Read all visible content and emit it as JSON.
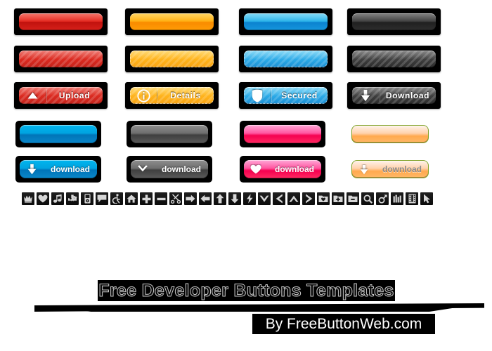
{
  "page": {
    "title": "Free Developer Buttons Templates",
    "credit": "By FreeButtonWeb.com",
    "background": "#ffffff"
  },
  "group1": {
    "plate_color": "#000000",
    "rows": [
      {
        "row_name": "plain",
        "buttons": [
          {
            "name": "red-plain-button",
            "label": "",
            "icon": "",
            "color": "#e32319",
            "striped": false
          },
          {
            "name": "orange-plain-button",
            "label": "",
            "icon": "",
            "color": "#ffad0a",
            "striped": false
          },
          {
            "name": "blue-plain-button",
            "label": "",
            "icon": "",
            "color": "#23b0e8",
            "striped": false
          },
          {
            "name": "dark-plain-button",
            "label": "",
            "icon": "",
            "color": "#3a3a3a",
            "striped": false
          }
        ]
      },
      {
        "row_name": "striped",
        "buttons": [
          {
            "name": "red-striped-button",
            "label": "",
            "icon": "",
            "color": "#dc2a20",
            "striped": true
          },
          {
            "name": "orange-striped-button",
            "label": "",
            "icon": "",
            "color": "#ffb41c",
            "striped": true
          },
          {
            "name": "blue-striped-button",
            "label": "",
            "icon": "",
            "color": "#2ba9e6",
            "striped": true
          },
          {
            "name": "dark-striped-button",
            "label": "",
            "icon": "",
            "color": "#404040",
            "striped": true
          }
        ]
      },
      {
        "row_name": "labeled",
        "buttons": [
          {
            "name": "upload-button",
            "label": "Upload",
            "icon": "triangle-up-icon",
            "color": "#dc2a20",
            "striped": true
          },
          {
            "name": "details-button",
            "label": "Details",
            "icon": "info-circle-icon",
            "color": "#ffb41c",
            "striped": true
          },
          {
            "name": "secured-button",
            "label": "Secured",
            "icon": "shield-icon",
            "color": "#2ba9e6",
            "striped": true
          },
          {
            "name": "download-button",
            "label": "Download",
            "icon": "arrow-down-icon",
            "color": "#404040",
            "striped": true
          }
        ]
      }
    ]
  },
  "group2": {
    "rows": [
      {
        "row_name": "plain",
        "buttons": [
          {
            "name": "blue-pill-plain",
            "label": "",
            "icon": "",
            "color": "#00a3e0",
            "plate": true
          },
          {
            "name": "gray-pill-plain",
            "label": "",
            "icon": "",
            "color": "#6e6e6e",
            "plate": true
          },
          {
            "name": "pink-pill-plain",
            "label": "",
            "icon": "",
            "color": "#ff56a0",
            "plate": true
          },
          {
            "name": "peach-pill-plain",
            "label": "",
            "icon": "",
            "color": "#ffb866",
            "plate": false
          }
        ]
      },
      {
        "row_name": "labeled",
        "buttons": [
          {
            "name": "blue-download-pill",
            "label": "download",
            "icon": "arrow-down-icon",
            "color": "#00a3e0",
            "plate": true,
            "label_dark": false
          },
          {
            "name": "gray-download-pill",
            "label": "download",
            "icon": "chevron-down-icon",
            "color": "#6e6e6e",
            "plate": true,
            "label_dark": false
          },
          {
            "name": "pink-download-pill",
            "label": "download",
            "icon": "heart-icon",
            "color": "#ff56a0",
            "plate": true,
            "label_dark": false
          },
          {
            "name": "peach-download-pill",
            "label": "download",
            "icon": "arrow-down-icon",
            "color": "#ffb866",
            "plate": false,
            "label_dark": true
          }
        ]
      }
    ]
  },
  "icon_strip": [
    "crown-icon",
    "heart-icon",
    "music-note-icon",
    "puzzle-piece-icon",
    "media-player-icon",
    "speech-bubble-icon",
    "wheelchair-icon",
    "home-icon",
    "plus-icon",
    "minus-icon",
    "scissors-icon",
    "arrow-right-icon",
    "arrow-left-icon",
    "arrow-up-icon",
    "arrow-down-icon",
    "lightning-icon",
    "chevron-down-icon",
    "chevron-left-icon",
    "chevron-up-icon",
    "chevron-right-icon",
    "folder-heart-icon",
    "folder-plus-icon",
    "folder-minus-icon",
    "search-icon",
    "male-symbol-icon",
    "bar-chart-icon",
    "film-strip-icon",
    "cursor-arrow-icon"
  ]
}
